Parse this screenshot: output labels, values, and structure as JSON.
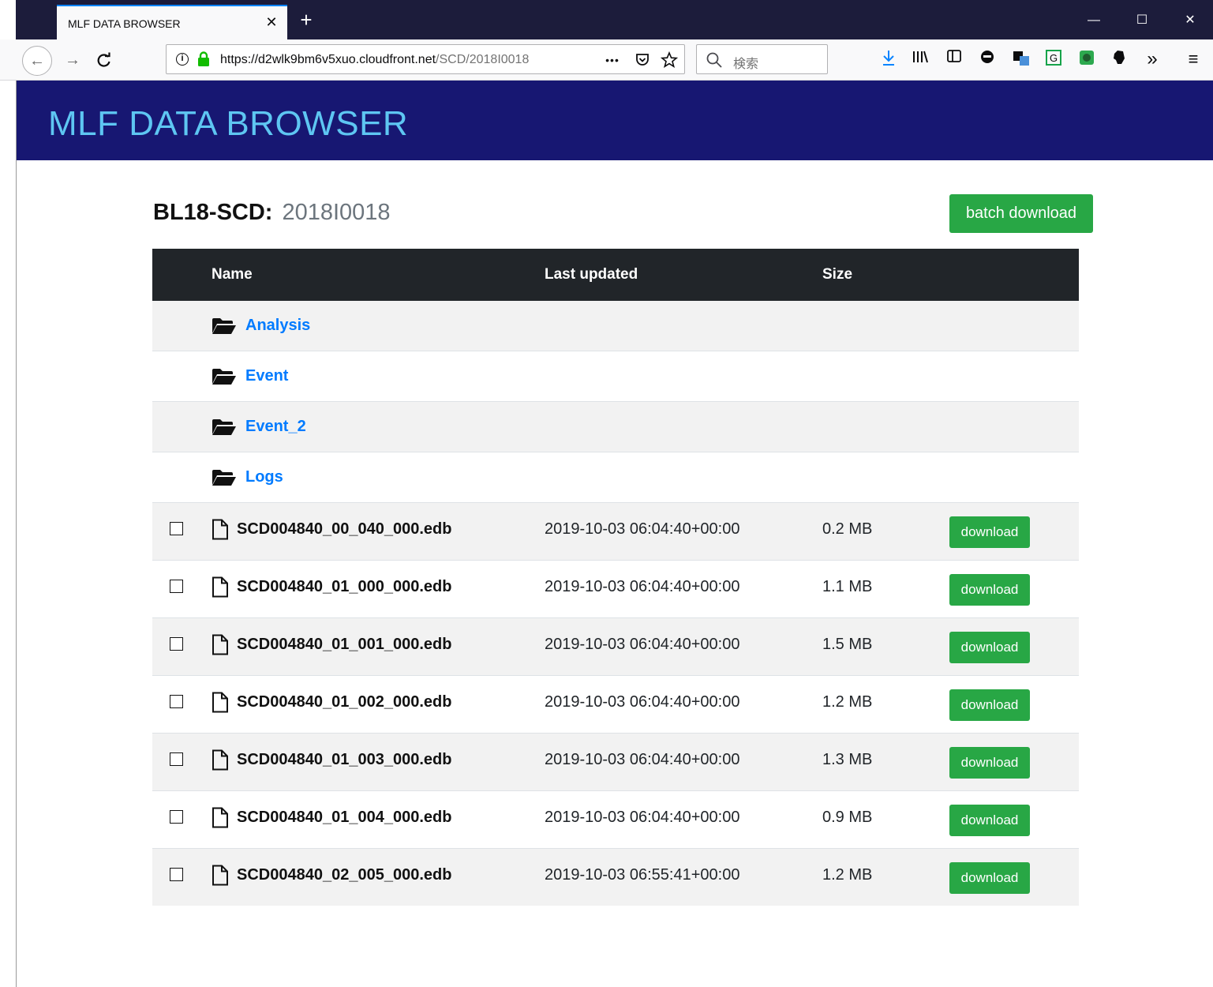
{
  "browser": {
    "tab_title": "MLF DATA BROWSER",
    "tab_close": "✕",
    "new_tab": "+",
    "url_host": "https://d2wlk9bm6v5xuo.cloudfront.net",
    "url_path": "/SCD/2018I0018",
    "url_more": "•••",
    "search_placeholder": "検索",
    "window_controls": {
      "minimize": "—",
      "maximize": "☐",
      "close": "✕"
    },
    "nav": {
      "back": "←",
      "forward": "→",
      "reload": "C"
    },
    "toolbar_icons": [
      "download-icon",
      "library-icon",
      "sidebar-icon",
      "pocket-icon",
      "translate-icon",
      "grammarly-icon",
      "extension-icon",
      "evernote-icon",
      "overflow-icon",
      "menu-icon"
    ],
    "overflow": "»",
    "menu": "≡"
  },
  "site": {
    "brand": "MLF DATA BROWSER",
    "brand_color": "#5ec6f2",
    "header_color": "#171772"
  },
  "page": {
    "heading_label": "BL18-SCD:",
    "heading_value": "2018I0018",
    "batch_download_label": "batch download"
  },
  "table": {
    "columns": [
      "Name",
      "Last updated",
      "Size"
    ],
    "folders": [
      {
        "name": "Analysis"
      },
      {
        "name": "Event"
      },
      {
        "name": "Event_2"
      },
      {
        "name": "Logs"
      }
    ],
    "files": [
      {
        "name": "SCD004840_00_040_000.edb",
        "updated": "2019-10-03 06:04:40+00:00",
        "size": "0.2 MB",
        "action": "download"
      },
      {
        "name": "SCD004840_01_000_000.edb",
        "updated": "2019-10-03 06:04:40+00:00",
        "size": "1.1 MB",
        "action": "download"
      },
      {
        "name": "SCD004840_01_001_000.edb",
        "updated": "2019-10-03 06:04:40+00:00",
        "size": "1.5 MB",
        "action": "download"
      },
      {
        "name": "SCD004840_01_002_000.edb",
        "updated": "2019-10-03 06:04:40+00:00",
        "size": "1.2 MB",
        "action": "download"
      },
      {
        "name": "SCD004840_01_003_000.edb",
        "updated": "2019-10-03 06:04:40+00:00",
        "size": "1.3 MB",
        "action": "download"
      },
      {
        "name": "SCD004840_01_004_000.edb",
        "updated": "2019-10-03 06:04:40+00:00",
        "size": "0.9 MB",
        "action": "download"
      },
      {
        "name": "SCD004840_02_005_000.edb",
        "updated": "2019-10-03 06:55:41+00:00",
        "size": "1.2 MB",
        "action": "download"
      }
    ]
  },
  "colors": {
    "success": "#28a745",
    "link": "#007bff",
    "table_head": "#212529"
  }
}
